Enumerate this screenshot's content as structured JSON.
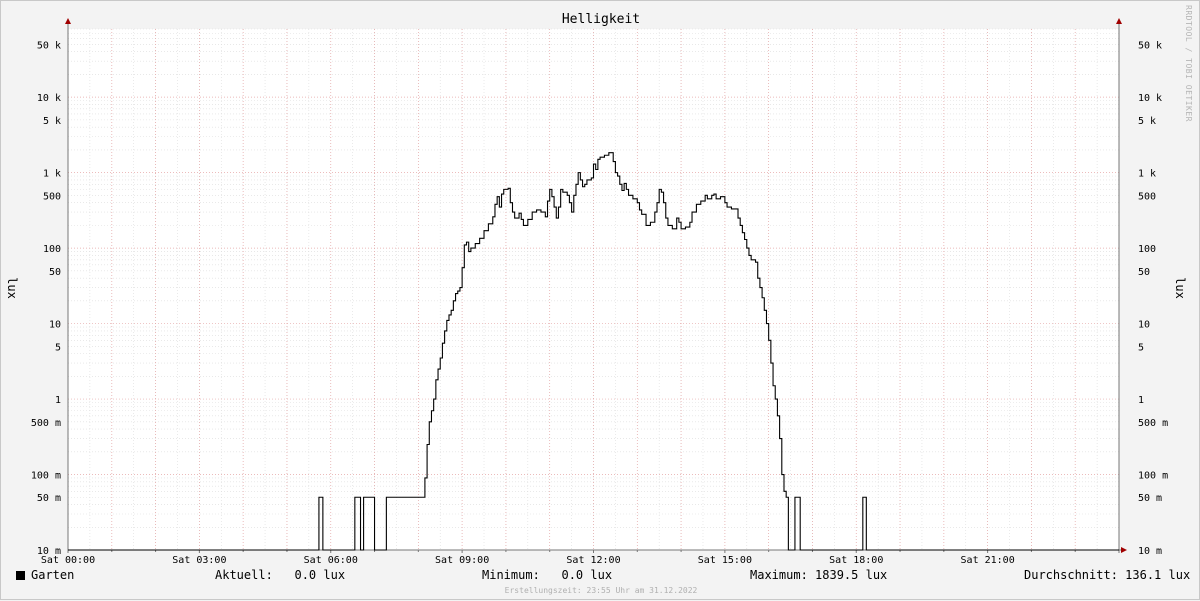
{
  "chart_data": {
    "type": "line",
    "title": "Helligkeit",
    "ylabel": "lux",
    "yscale": "log",
    "ylim": [
      0.01,
      80000
    ],
    "xlim": [
      0,
      24
    ],
    "x_ticks": [
      {
        "x": 0,
        "label": "Sat 00:00"
      },
      {
        "x": 3,
        "label": "Sat 03:00"
      },
      {
        "x": 6,
        "label": "Sat 06:00"
      },
      {
        "x": 9,
        "label": "Sat 09:00"
      },
      {
        "x": 12,
        "label": "Sat 12:00"
      },
      {
        "x": 15,
        "label": "Sat 15:00"
      },
      {
        "x": 18,
        "label": "Sat 18:00"
      },
      {
        "x": 21,
        "label": "Sat 21:00"
      }
    ],
    "y_ticks": [
      {
        "v": 50000,
        "label": "50 k"
      },
      {
        "v": 10000,
        "label": "10 k"
      },
      {
        "v": 5000,
        "label": "5 k"
      },
      {
        "v": 1000,
        "label": "1 k"
      },
      {
        "v": 500,
        "label": "500"
      },
      {
        "v": 100,
        "label": "100"
      },
      {
        "v": 50,
        "label": "50"
      },
      {
        "v": 10,
        "label": "10"
      },
      {
        "v": 5,
        "label": "5"
      },
      {
        "v": 1,
        "label": "1"
      },
      {
        "v": 0.5,
        "label": "500 m"
      },
      {
        "v": 0.1,
        "label": "100 m"
      },
      {
        "v": 0.05,
        "label": "50 m"
      },
      {
        "v": 0.01,
        "label": "10 m"
      }
    ],
    "series": [
      {
        "name": "Garten",
        "color": "#000000",
        "points": [
          [
            0.0,
            0.01
          ],
          [
            5.73,
            0.01
          ],
          [
            5.73,
            0.05
          ],
          [
            5.82,
            0.05
          ],
          [
            5.82,
            0.01
          ],
          [
            6.55,
            0.01
          ],
          [
            6.55,
            0.05
          ],
          [
            6.68,
            0.05
          ],
          [
            6.68,
            0.01
          ],
          [
            6.75,
            0.01
          ],
          [
            6.75,
            0.05
          ],
          [
            7.0,
            0.05
          ],
          [
            7.0,
            0.01
          ],
          [
            7.27,
            0.01
          ],
          [
            7.27,
            0.05
          ],
          [
            8.1,
            0.05
          ],
          [
            8.15,
            0.09
          ],
          [
            8.2,
            0.25
          ],
          [
            8.25,
            0.5
          ],
          [
            8.3,
            0.7
          ],
          [
            8.35,
            1.0
          ],
          [
            8.4,
            1.8
          ],
          [
            8.45,
            2.5
          ],
          [
            8.5,
            3.5
          ],
          [
            8.55,
            5.5
          ],
          [
            8.6,
            8.0
          ],
          [
            8.65,
            11.0
          ],
          [
            8.7,
            13.0
          ],
          [
            8.75,
            15.0
          ],
          [
            8.8,
            20.0
          ],
          [
            8.85,
            25.0
          ],
          [
            8.9,
            27.0
          ],
          [
            8.95,
            30.0
          ],
          [
            9.0,
            55.0
          ],
          [
            9.05,
            110.0
          ],
          [
            9.1,
            120.0
          ],
          [
            9.15,
            90.0
          ],
          [
            9.2,
            100.0
          ],
          [
            9.3,
            115.0
          ],
          [
            9.4,
            135.0
          ],
          [
            9.5,
            170.0
          ],
          [
            9.6,
            210.0
          ],
          [
            9.7,
            260.0
          ],
          [
            9.75,
            380.0
          ],
          [
            9.8,
            480.0
          ],
          [
            9.85,
            350.0
          ],
          [
            9.9,
            520.0
          ],
          [
            9.95,
            600.0
          ],
          [
            10.05,
            620.0
          ],
          [
            10.1,
            400.0
          ],
          [
            10.15,
            300.0
          ],
          [
            10.2,
            250.0
          ],
          [
            10.3,
            290.0
          ],
          [
            10.35,
            240.0
          ],
          [
            10.4,
            200.0
          ],
          [
            10.5,
            240.0
          ],
          [
            10.6,
            300.0
          ],
          [
            10.7,
            320.0
          ],
          [
            10.8,
            300.0
          ],
          [
            10.9,
            260.0
          ],
          [
            10.95,
            420.0
          ],
          [
            11.0,
            600.0
          ],
          [
            11.05,
            480.0
          ],
          [
            11.1,
            350.0
          ],
          [
            11.15,
            250.0
          ],
          [
            11.2,
            350.0
          ],
          [
            11.25,
            600.0
          ],
          [
            11.3,
            550.0
          ],
          [
            11.4,
            500.0
          ],
          [
            11.45,
            400.0
          ],
          [
            11.5,
            300.0
          ],
          [
            11.55,
            500.0
          ],
          [
            11.6,
            700.0
          ],
          [
            11.65,
            1000.0
          ],
          [
            11.7,
            800.0
          ],
          [
            11.75,
            650.0
          ],
          [
            11.8,
            700.0
          ],
          [
            11.85,
            800.0
          ],
          [
            11.95,
            850.0
          ],
          [
            12.0,
            1300.0
          ],
          [
            12.05,
            1100.0
          ],
          [
            12.1,
            1500.0
          ],
          [
            12.15,
            1600.0
          ],
          [
            12.25,
            1700.0
          ],
          [
            12.35,
            1839.5
          ],
          [
            12.45,
            1400.0
          ],
          [
            12.5,
            1000.0
          ],
          [
            12.55,
            900.0
          ],
          [
            12.6,
            700.0
          ],
          [
            12.65,
            580.0
          ],
          [
            12.7,
            720.0
          ],
          [
            12.75,
            600.0
          ],
          [
            12.8,
            500.0
          ],
          [
            12.9,
            450.0
          ],
          [
            13.0,
            400.0
          ],
          [
            13.05,
            320.0
          ],
          [
            13.1,
            280.0
          ],
          [
            13.2,
            200.0
          ],
          [
            13.3,
            220.0
          ],
          [
            13.4,
            300.0
          ],
          [
            13.45,
            400.0
          ],
          [
            13.5,
            600.0
          ],
          [
            13.55,
            550.0
          ],
          [
            13.6,
            400.0
          ],
          [
            13.65,
            250.0
          ],
          [
            13.7,
            200.0
          ],
          [
            13.8,
            180.0
          ],
          [
            13.9,
            250.0
          ],
          [
            13.95,
            220.0
          ],
          [
            14.0,
            180.0
          ],
          [
            14.1,
            190.0
          ],
          [
            14.2,
            220.0
          ],
          [
            14.25,
            300.0
          ],
          [
            14.35,
            380.0
          ],
          [
            14.45,
            420.0
          ],
          [
            14.55,
            500.0
          ],
          [
            14.6,
            450.0
          ],
          [
            14.7,
            500.0
          ],
          [
            14.75,
            520.0
          ],
          [
            14.8,
            450.0
          ],
          [
            14.9,
            480.0
          ],
          [
            15.0,
            400.0
          ],
          [
            15.05,
            350.0
          ],
          [
            15.15,
            330.0
          ],
          [
            15.3,
            250.0
          ],
          [
            15.35,
            200.0
          ],
          [
            15.4,
            160.0
          ],
          [
            15.45,
            130.0
          ],
          [
            15.5,
            100.0
          ],
          [
            15.55,
            80.0
          ],
          [
            15.6,
            70.0
          ],
          [
            15.7,
            65.0
          ],
          [
            15.75,
            40.0
          ],
          [
            15.8,
            30.0
          ],
          [
            15.85,
            22.0
          ],
          [
            15.9,
            15.0
          ],
          [
            15.95,
            10.0
          ],
          [
            16.0,
            6.0
          ],
          [
            16.05,
            3.0
          ],
          [
            16.1,
            1.5
          ],
          [
            16.15,
            1.0
          ],
          [
            16.2,
            0.6
          ],
          [
            16.25,
            0.3
          ],
          [
            16.3,
            0.1
          ],
          [
            16.35,
            0.06
          ],
          [
            16.4,
            0.05
          ],
          [
            16.45,
            0.05
          ],
          [
            16.45,
            0.01
          ],
          [
            16.6,
            0.01
          ],
          [
            16.6,
            0.05
          ],
          [
            16.72,
            0.05
          ],
          [
            16.72,
            0.01
          ],
          [
            18.15,
            0.01
          ],
          [
            18.15,
            0.05
          ],
          [
            18.23,
            0.05
          ],
          [
            18.23,
            0.01
          ],
          [
            24.0,
            0.01
          ]
        ]
      }
    ]
  },
  "legend": {
    "series_name": "Garten",
    "aktuell": "Aktuell:   0.0 lux",
    "minimum": "Minimum:   0.0 lux",
    "maximum": "Maximum: 1839.5 lux",
    "durchschnitt": "Durchschnitt: 136.1 lux"
  },
  "watermark": "RRDTOOL / TOBI OETIKER",
  "footer": "Erstellungszeit: 23:55 Uhr am 31.12.2022"
}
